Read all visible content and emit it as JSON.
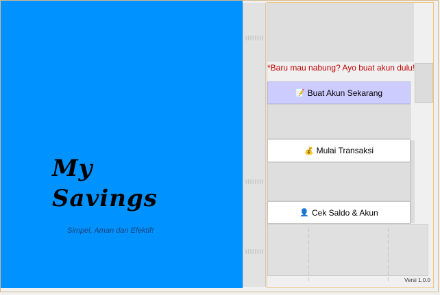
{
  "app": {
    "title_line1": "My",
    "title_line2": "Savings",
    "tagline": "Simpel, Aman dan Efektif!"
  },
  "notice": "*Baru mau nabung? Ayo buat akun dulu!",
  "buttons": {
    "create_account": {
      "icon": "📝",
      "label": "Buat Akun Sekarang"
    },
    "start_transaction": {
      "icon": "💰",
      "label": "Mulai Transaksi"
    },
    "check_balance": {
      "icon": "👤",
      "label": "Cek Saldo & Akun"
    }
  },
  "version": "Versi 1.0.0",
  "colors": {
    "left_panel": "#0093ff",
    "primary_button": "#ccccff",
    "notice_text": "#c00000"
  },
  "icons": [
    "memo-icon",
    "money-bag-icon",
    "person-icon"
  ]
}
